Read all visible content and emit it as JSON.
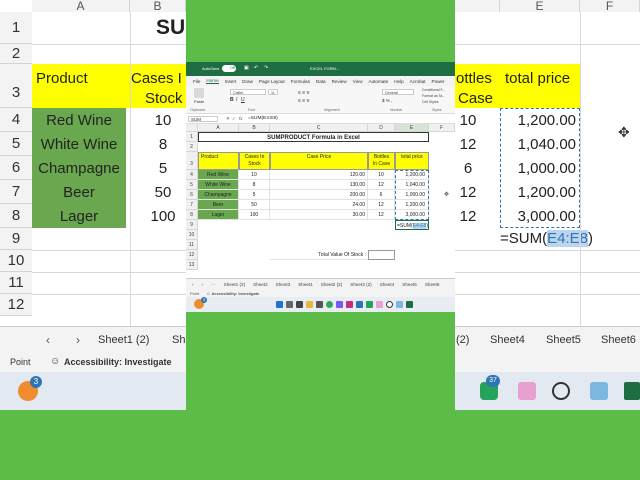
{
  "background_sheet": {
    "col_headers": [
      "A",
      "B",
      "E",
      "F"
    ],
    "row_headers": [
      "1",
      "2",
      "3",
      "4",
      "5",
      "6",
      "7",
      "8",
      "9",
      "10",
      "11",
      "12"
    ],
    "title_fragment": "SUM",
    "header_product": "Product",
    "header_cases_1": "Cases I",
    "header_cases_2": "Stock",
    "header_bottles_1": "ottles",
    "header_bottles_2": "Case",
    "header_total": "total price",
    "products": [
      "Red Wine",
      "White Wine",
      "Champagne",
      "Beer",
      "Lager"
    ],
    "cases": [
      "10",
      "8",
      "5",
      "50",
      "100"
    ],
    "bottles": [
      "10",
      "12",
      "6",
      "12",
      "12"
    ],
    "totals": [
      "1,200.00",
      "1,040.00",
      "1,000.00",
      "1,200.00",
      "3,000.00"
    ],
    "formula_left": "=SUM(",
    "formula_ref": "E4:E8",
    "formula_right": ")",
    "sheet_tabs": [
      "Sheet1 (2)",
      "Sh",
      "(2)",
      "Sheet4",
      "Sheet5",
      "Sheet6"
    ],
    "status_point": "Point",
    "status_accessibility": "Accessibility: Investigate",
    "badge_left": "3",
    "badge_right": "37"
  },
  "window": {
    "title_autosave": "AutoSave",
    "title_toggle": "Off",
    "title_doc": "EXCEL FORM...",
    "menu": [
      "File",
      "Home",
      "Insert",
      "Draw",
      "Page Layout",
      "Formulas",
      "Data",
      "Review",
      "View",
      "Automate",
      "Help",
      "Acrobat",
      "Power"
    ],
    "ribbon_groups": [
      "Clipboard",
      "Font",
      "Alignment",
      "Number",
      "Styles"
    ],
    "ribbon_paste": "Paste",
    "ribbon_font": "Calibri",
    "ribbon_font_size": "11",
    "ribbon_number": "General",
    "ribbon_styles": [
      "Conditional F...",
      "Format as Ta...",
      "Cell Styles"
    ],
    "name_box": "SUM",
    "formula_fx": "fx",
    "formula_text": "=SUM(E4:E8)",
    "col_headers": [
      "A",
      "B",
      "C",
      "D",
      "E",
      "F"
    ],
    "row_headers": [
      "1",
      "2",
      "3",
      "4",
      "5",
      "6",
      "7",
      "8",
      "9",
      "10",
      "11",
      "12",
      "13"
    ],
    "sheet_title": "SUMPRODUCT Formula in Excel",
    "headers": {
      "product": "Product",
      "cases_1": "Cases In",
      "cases_2": "Stock",
      "case_price": "Case Price",
      "bottles_1": "Bottles",
      "bottles_2": "In Case",
      "total": "total price"
    },
    "rows": [
      {
        "product": "Red Wine",
        "cases": "10",
        "price": "120.00",
        "bottles": "10",
        "total": "1,200.00"
      },
      {
        "product": "White Wine",
        "cases": "8",
        "price": "130.00",
        "bottles": "12",
        "total": "1,040.00"
      },
      {
        "product": "Champagne",
        "cases": "5",
        "price": "200.00",
        "bottles": "6",
        "total": "1,000.00"
      },
      {
        "product": "Beer",
        "cases": "50",
        "price": "24.00",
        "bottles": "12",
        "total": "1,200.00"
      },
      {
        "product": "Lager",
        "cases": "100",
        "price": "30.00",
        "bottles": "12",
        "total": "3,000.00"
      }
    ],
    "edit_left": "=SUM(",
    "edit_ref": "E4:E8",
    "edit_right": ")",
    "total_stock_label": "Total Value Of Stock :",
    "sheet_tabs": [
      "Sheet1 (2)",
      "Sheet2",
      "Sheet3",
      "Sheet1",
      "Sheet2 (2)",
      "Sheet3 (2)",
      "Sheet4",
      "Sheet5",
      "Sheet6"
    ],
    "status_point": "Point",
    "status_accessibility": "Accessibility: Investigate",
    "badge": "3"
  },
  "colors": {
    "green": "#5bbd47",
    "yellow": "#ffff00",
    "excel_green": "#1f6e43",
    "product_green": "#6aa84f",
    "selection_blue": "#2f75b5"
  }
}
